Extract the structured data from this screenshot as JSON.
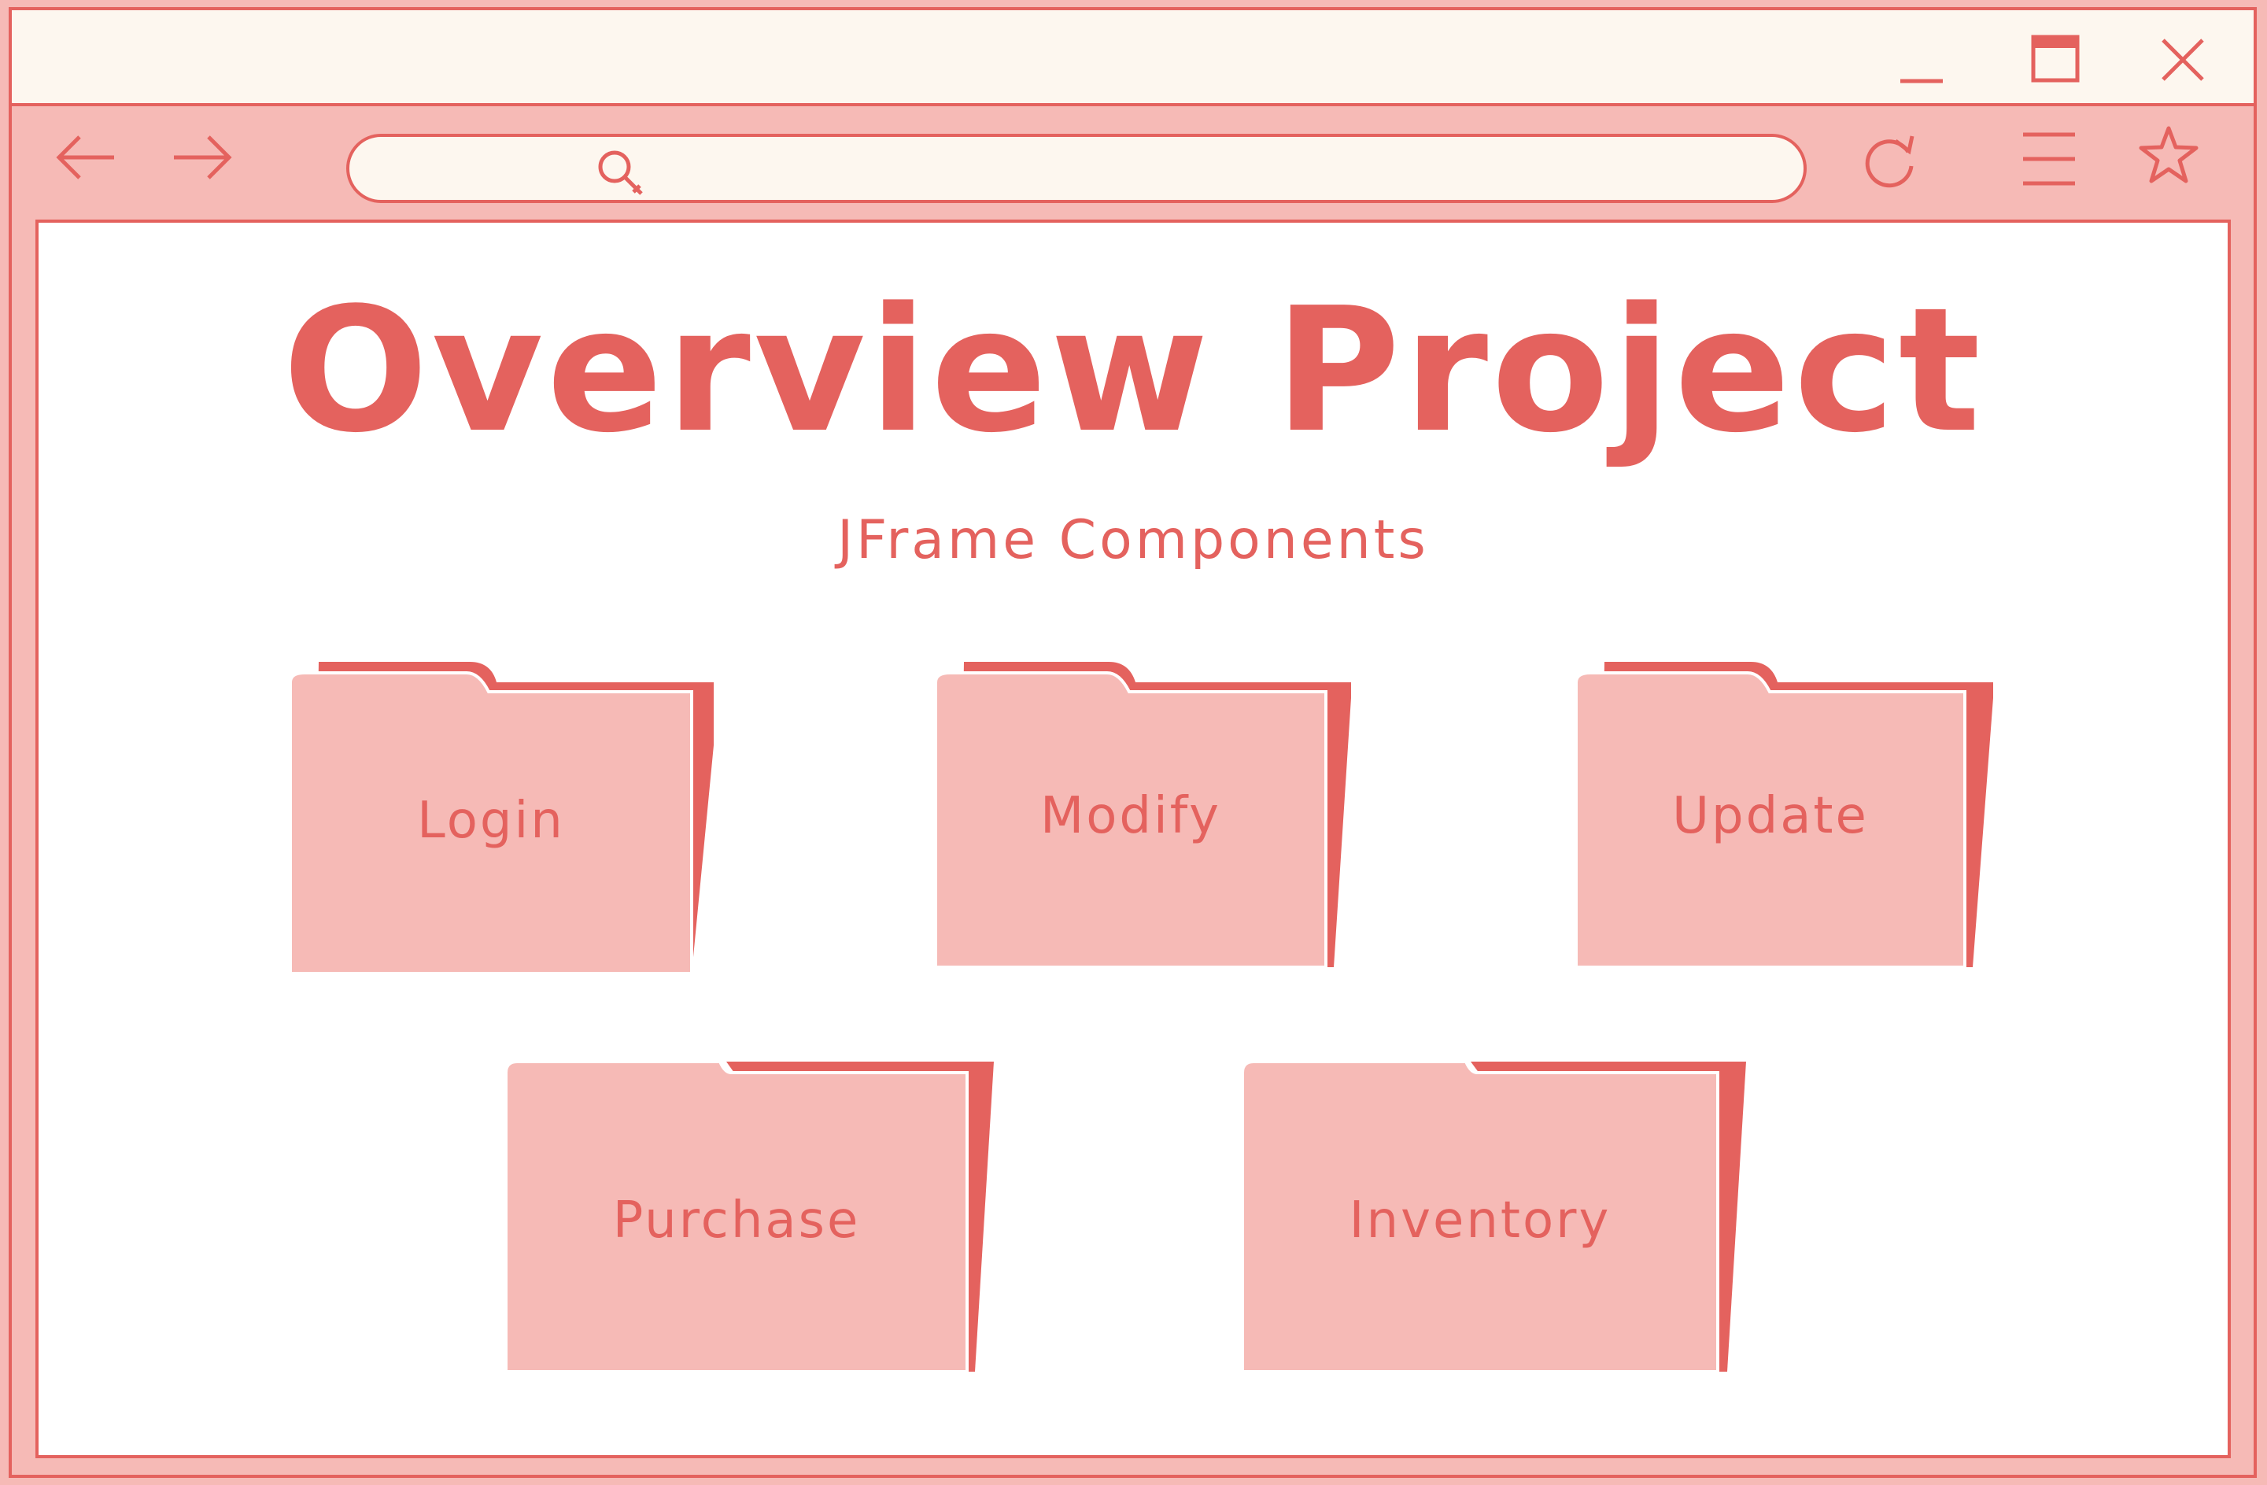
{
  "window": {
    "controls": [
      {
        "name": "minimize-button",
        "icon": "minimize-icon"
      },
      {
        "name": "maximize-button",
        "icon": "maximize-icon"
      },
      {
        "name": "close-button",
        "icon": "close-icon"
      }
    ]
  },
  "toolbar": {
    "back_icon": "arrow-left-icon",
    "forward_icon": "arrow-right-icon",
    "search_icon": "search-icon",
    "address_value": "",
    "reload_icon": "reload-icon",
    "menu_icon": "hamburger-menu-icon",
    "bookmark_icon": "star-icon"
  },
  "page": {
    "title": "Overview Project",
    "subtitle": "JFrame Components",
    "folders": [
      {
        "label": "Login",
        "icon": "folder-icon"
      },
      {
        "label": "Modify",
        "icon": "folder-icon"
      },
      {
        "label": "Update",
        "icon": "folder-icon"
      },
      {
        "label": "Purchase",
        "icon": "folder-icon"
      },
      {
        "label": "Inventory",
        "icon": "folder-icon"
      }
    ]
  },
  "colors": {
    "accent": "#e4625e",
    "folder_fill": "#f6bab6",
    "chrome_background": "#fdf7ef",
    "content_background": "#ffffff"
  }
}
